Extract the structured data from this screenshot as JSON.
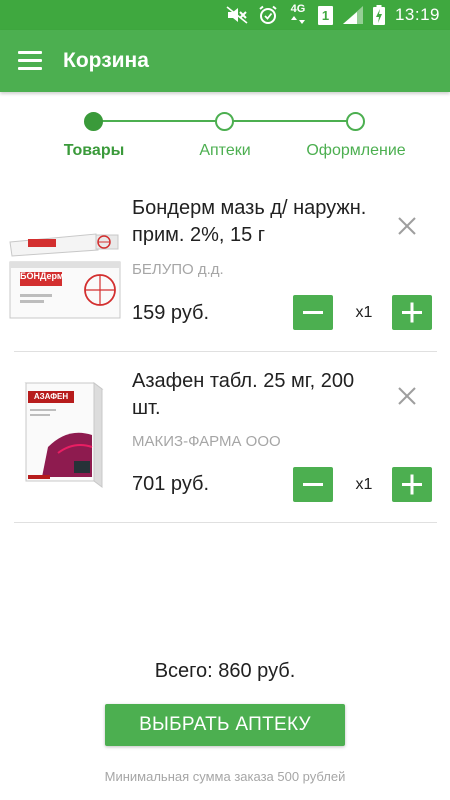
{
  "status_bar": {
    "network": "4G",
    "sim_slot": "1",
    "time": "13:19",
    "icons": [
      "mute-icon",
      "alarm-icon",
      "network-4g-icon",
      "sim-icon",
      "signal-icon",
      "battery-charging-icon"
    ]
  },
  "app_bar": {
    "title": "Корзина",
    "menu_icon": "menu-icon"
  },
  "stepper": {
    "steps": [
      {
        "label": "Товары",
        "active": true
      },
      {
        "label": "Аптеки",
        "active": false
      },
      {
        "label": "Оформление",
        "active": false
      }
    ]
  },
  "cart": {
    "items": [
      {
        "name": "Бондерм мазь д/ наружн. прим. 2%, 15 г",
        "maker": "БЕЛУПО д.д.",
        "price": "159 руб.",
        "quantity": "x1",
        "image_icon": "bonderm-package-image",
        "package_text": "БОНДерм"
      },
      {
        "name": "Азафен табл. 25 мг, 200 шт.",
        "maker": "МАКИЗ-ФАРМА ООО",
        "price": "701 руб.",
        "quantity": "x1",
        "image_icon": "azafen-package-image",
        "package_text": "АЗАФЕН"
      }
    ]
  },
  "summary": {
    "total": "Всего: 860 руб.",
    "button_label": "ВЫБРАТЬ АПТЕКУ",
    "min_note": "Минимальная сумма заказа 500 рублей"
  },
  "colors": {
    "accent": "#4caf50",
    "status_bar": "#3fa83f",
    "secondary_text": "#a6a6a6"
  }
}
